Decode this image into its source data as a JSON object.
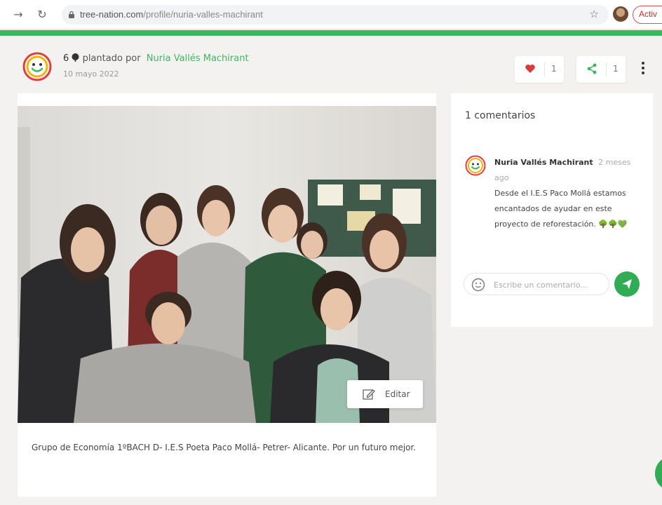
{
  "browser": {
    "url_host": "tree-nation.com",
    "url_path": "/profile/nuria-valles-machirant",
    "activate_label": "Activ"
  },
  "post": {
    "tree_count": "6",
    "planted_by_label": "plantado por",
    "author": "Nuria Vallés Machirant",
    "date": "10 mayo 2022",
    "likes": "1",
    "shares": "1",
    "edit_label": "Editar",
    "caption": "Grupo de Economía 1ºBACH D- I.E.S Poeta Paco Mollá- Petrer- Alicante. Por un futuro mejor."
  },
  "comments": {
    "title": "1 comentarios",
    "items": [
      {
        "author": "Nuria Vallés Machirant",
        "time": "2 meses ago",
        "text": "Desde el I.E.S Paco Mollá estamos encantados de ayudar en este proyecto de reforestación. 🌳🌳💚"
      }
    ],
    "input_placeholder": "Escribe un comentario..."
  },
  "colors": {
    "brand_green": "#3fb560",
    "heart_red": "#d93a3a"
  }
}
